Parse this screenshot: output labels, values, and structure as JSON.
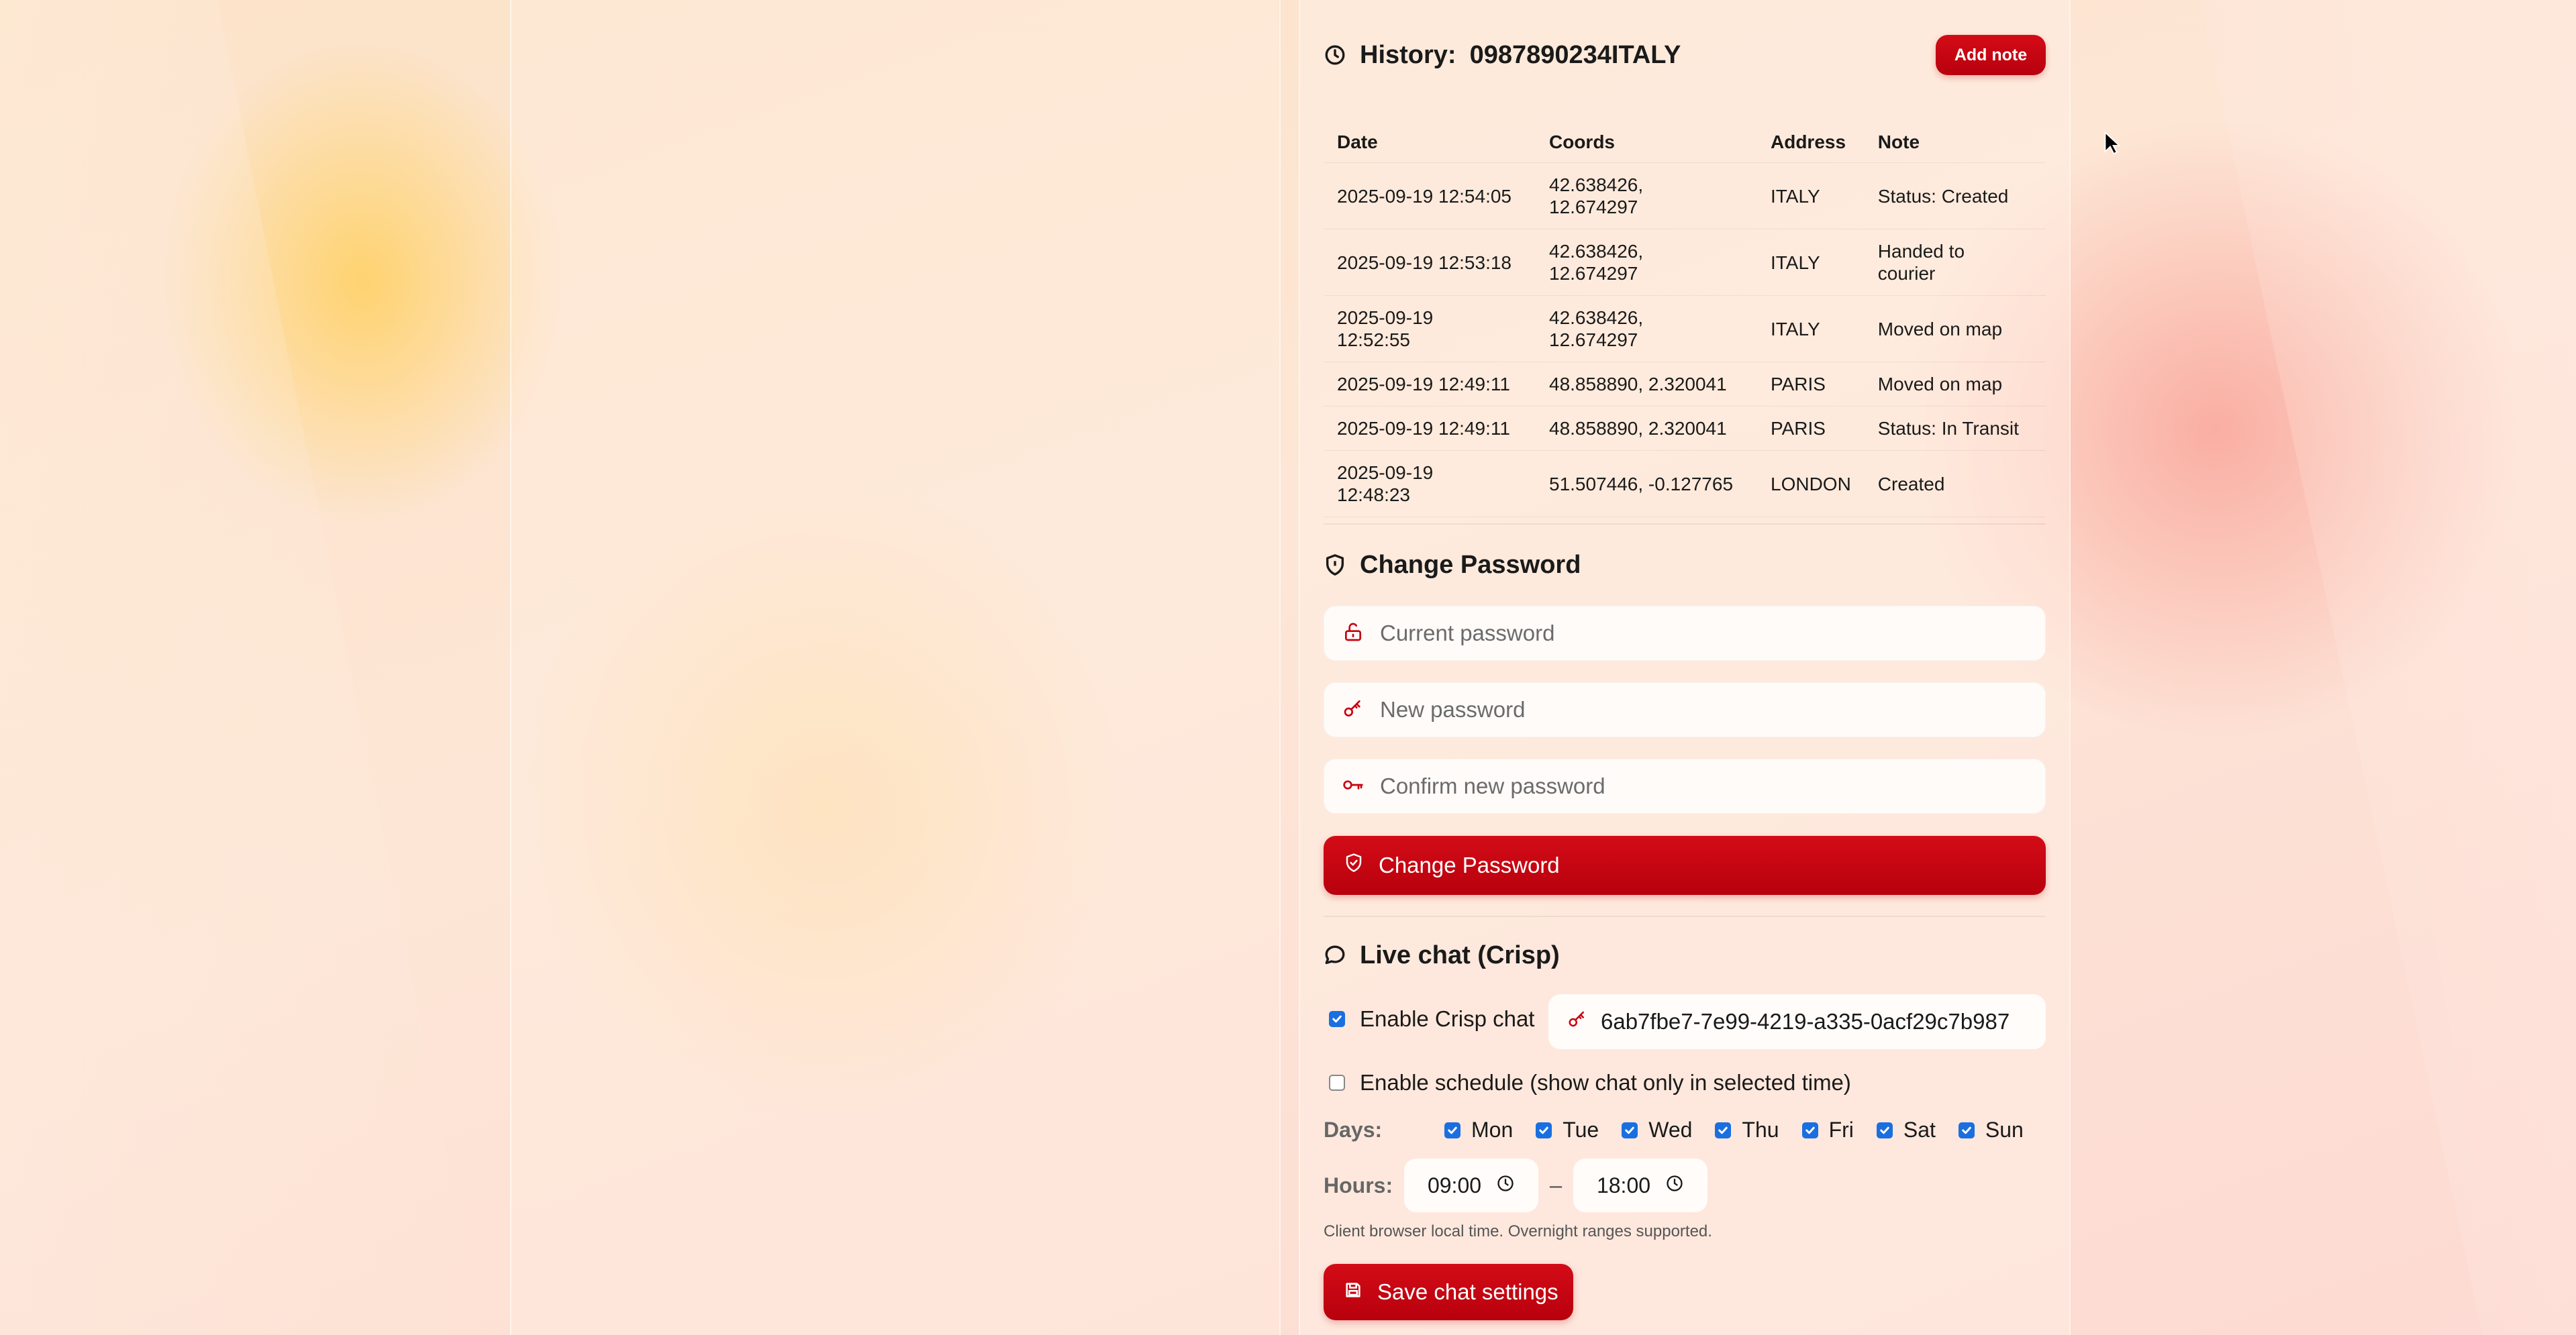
{
  "history": {
    "label": "History:",
    "code": "0987890234ITALY",
    "add_note": "Add note",
    "columns": [
      "Date",
      "Coords",
      "Address",
      "Note"
    ],
    "rows": [
      {
        "date": "2025-09-19 12:54:05",
        "coords": "42.638426, 12.674297",
        "address": "ITALY",
        "note": "Status: Created"
      },
      {
        "date": "2025-09-19 12:53:18",
        "coords": "42.638426, 12.674297",
        "address": "ITALY",
        "note": "Handed to courier"
      },
      {
        "date": "2025-09-19 12:52:55",
        "coords": "42.638426, 12.674297",
        "address": "ITALY",
        "note": "Moved on map"
      },
      {
        "date": "2025-09-19 12:49:11",
        "coords": "48.858890, 2.320041",
        "address": "PARIS",
        "note": "Moved on map"
      },
      {
        "date": "2025-09-19 12:49:11",
        "coords": "48.858890, 2.320041",
        "address": "PARIS",
        "note": "Status: In Transit"
      },
      {
        "date": "2025-09-19 12:48:23",
        "coords": "51.507446, -0.127765",
        "address": "LONDON",
        "note": "Created"
      }
    ]
  },
  "password": {
    "title": "Change Password",
    "current_placeholder": "Current password",
    "new_placeholder": "New password",
    "confirm_placeholder": "Confirm new password",
    "submit": "Change Password"
  },
  "chat": {
    "title": "Live chat (Crisp)",
    "enable_label": "Enable Crisp chat",
    "enable_checked": true,
    "website_id": "6ab7fbe7-7e99-4219-a335-0acf29c7b987",
    "schedule_label": "Enable schedule (show chat only in selected time)",
    "schedule_checked": false,
    "days_label": "Days:",
    "days": [
      {
        "label": "Mon",
        "checked": true
      },
      {
        "label": "Tue",
        "checked": true
      },
      {
        "label": "Wed",
        "checked": true
      },
      {
        "label": "Thu",
        "checked": true
      },
      {
        "label": "Fri",
        "checked": true
      },
      {
        "label": "Sat",
        "checked": true
      },
      {
        "label": "Sun",
        "checked": true
      }
    ],
    "hours_label": "Hours:",
    "hours_from": "09:00",
    "hours_separator": "–",
    "hours_to": "18:00",
    "hint": "Client browser local time. Overnight ranges supported.",
    "save": "Save chat settings"
  },
  "colors": {
    "accent": "#c8000f",
    "checkbox": "#1a6fe0"
  },
  "icons": [
    "clock-icon",
    "shield-icon",
    "unlock-icon",
    "key-icon",
    "key-round-icon",
    "shield-check-icon",
    "chat-bubble-icon",
    "save-icon"
  ]
}
